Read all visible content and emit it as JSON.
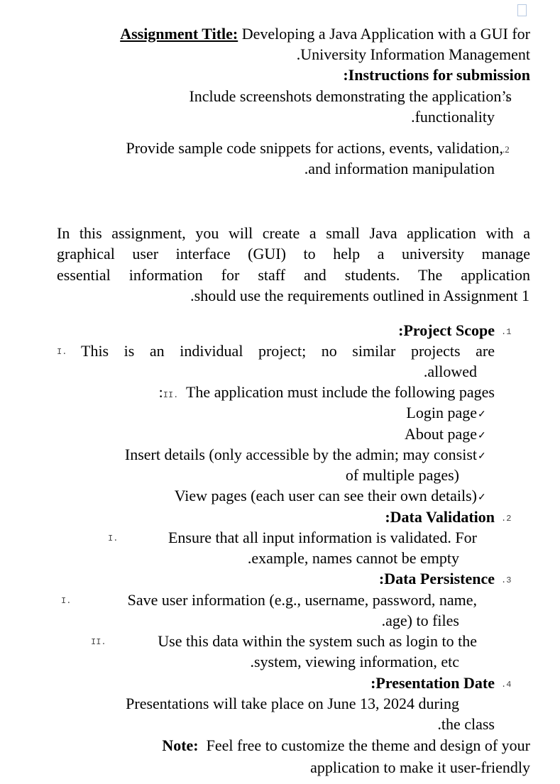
{
  "document": {
    "title_label": "Assignment Title:",
    "title_text_line1": " Developing a Java Application with a GUI for",
    "title_text_line2": ".University Information Management",
    "instructions_heading": ":Instructions for submission",
    "instructions": [
      {
        "number": ".1",
        "line1": "Include screenshots demonstrating the application’s",
        "line2": ".functionality"
      },
      {
        "number": ".2",
        "line1": "Provide sample code snippets for actions, events, validation,",
        "line2": ".and information manipulation"
      }
    ],
    "intro_lines": [
      "In this assignment, you will create a small Java application with a",
      "graphical user interface (GUI) to help a university manage",
      "essential information for staff and students. The application",
      ".should use the requirements outlined in Assignment 1"
    ],
    "sections": {
      "project_scope": {
        "number": ".1",
        "heading": ":Project Scope",
        "item1_marker": "I.",
        "item1_line1": "This is an individual project; no similar projects are",
        "item1_line2": ".allowed",
        "item2_marker": "II.",
        "item2_prefix": ":",
        "item2_line1": "The application must include the following pages",
        "pages": [
          {
            "line1": "Login page"
          },
          {
            "line1": "About page"
          },
          {
            "line1": "Insert details (only accessible by the admin; may consist",
            "line2": "of multiple pages)"
          },
          {
            "line1": "View pages (each user can see their own details)"
          }
        ],
        "check_glyph": "✓"
      },
      "data_validation": {
        "number": ".2",
        "heading": ":Data Validation",
        "item1_marker": "I.",
        "item1_line1": "Ensure that all input information is validated. For",
        "item1_line2": ".example, names cannot be empty"
      },
      "data_persistence": {
        "number": ".3",
        "heading": ":Data Persistence",
        "item1_marker": "I.",
        "item1_line1": "Save user information (e.g., username, password, name,",
        "item1_line2": ".age) to files",
        "item2_marker": "II.",
        "item2_line1": "Use this data within the system such as login to the",
        "item2_line2": ".system, viewing information, etc"
      },
      "presentation_date": {
        "number": ".4",
        "heading": ":Presentation Date",
        "line1": "Presentations will take place on June 13, 2024 during",
        "line2": ".the class"
      }
    },
    "note": {
      "label": "Note:",
      "line1": "  Feel free to customize the theme and design of your",
      "line2": "application to make it user-friendly"
    }
  }
}
